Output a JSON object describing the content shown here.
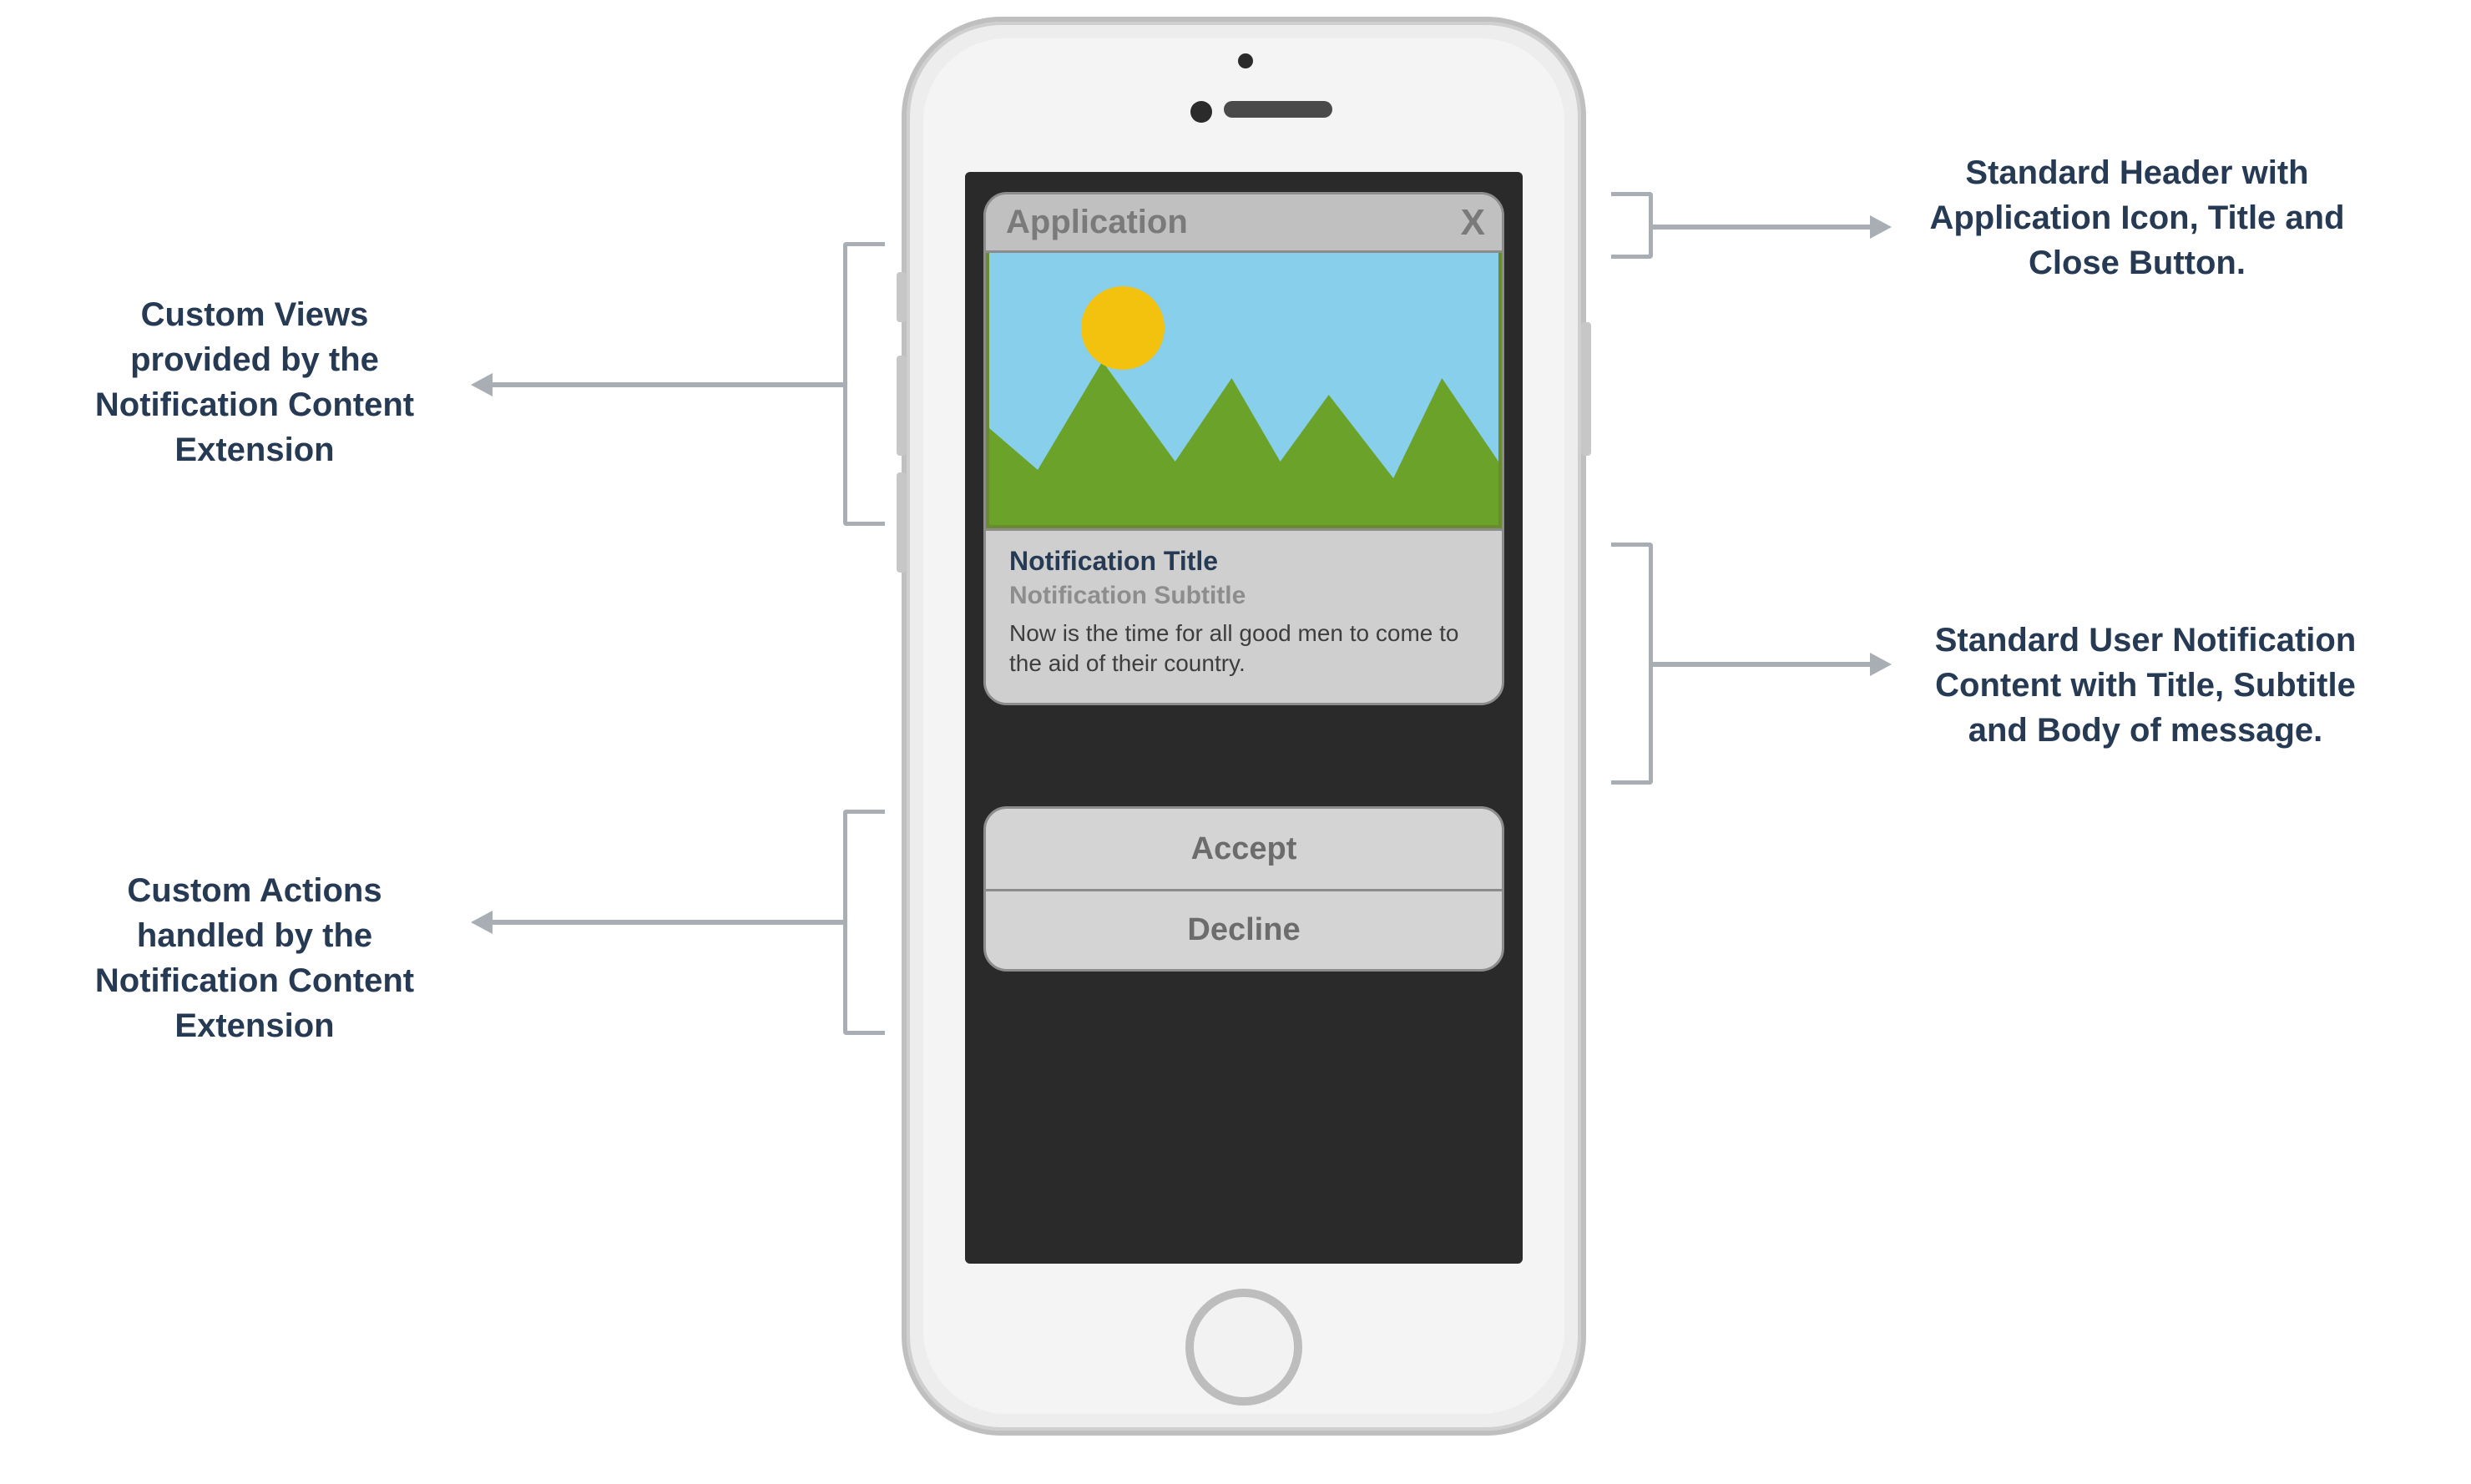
{
  "callouts": {
    "left_view": "Custom Views provided by the Notification Content Extension",
    "left_actions": "Custom Actions handled by the Notification Content Extension",
    "right_header": "Standard Header with Application Icon, Title and Close Button.",
    "right_content": "Standard User Notification Content with Title, Subtitle and Body of message."
  },
  "notification": {
    "app_title": "Application",
    "close_label": "X",
    "title": "Notification Title",
    "subtitle": "Notification Subtitle",
    "body": "Now is the time for all good men to come to the aid of their country."
  },
  "actions": {
    "accept": "Accept",
    "decline": "Decline"
  },
  "colors": {
    "text": "#273a54",
    "arrow": "#a8aeb4",
    "sky": "#87CFEB",
    "sun": "#F2C20F",
    "ground": "#6BA22A"
  }
}
